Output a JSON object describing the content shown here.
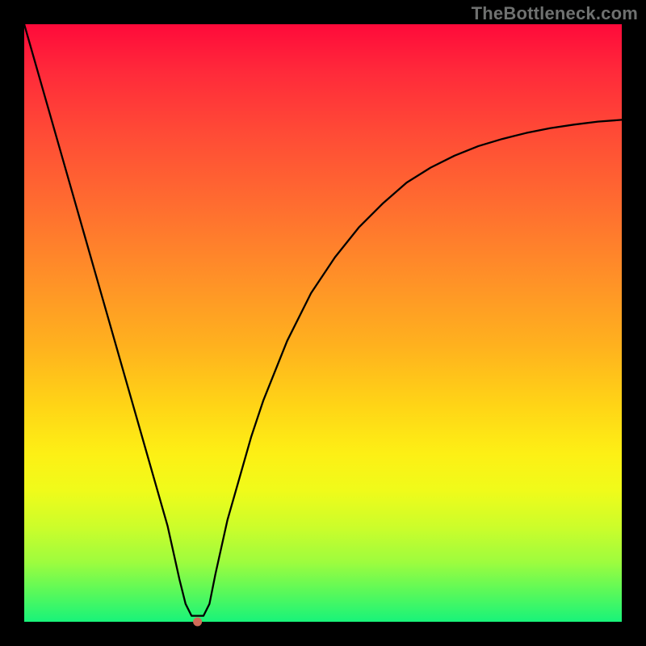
{
  "watermark": "TheBottleneck.com",
  "chart_data": {
    "type": "line",
    "title": "",
    "xlabel": "",
    "ylabel": "",
    "xlim": [
      0,
      100
    ],
    "ylim": [
      0,
      100
    ],
    "grid": false,
    "legend": false,
    "series": [
      {
        "name": "bottleneck-curve",
        "x": [
          0,
          2,
          4,
          6,
          8,
          10,
          12,
          14,
          16,
          18,
          20,
          22,
          24,
          26,
          27,
          28,
          29,
          30,
          31,
          32,
          34,
          36,
          38,
          40,
          44,
          48,
          52,
          56,
          60,
          64,
          68,
          72,
          76,
          80,
          84,
          88,
          92,
          96,
          100
        ],
        "y": [
          100,
          93,
          86,
          79,
          72,
          65,
          58,
          51,
          44,
          37,
          30,
          23,
          16,
          7,
          3,
          1,
          1,
          1,
          3,
          8,
          17,
          24,
          31,
          37,
          47,
          55,
          61,
          66,
          70,
          73.5,
          76,
          78,
          79.6,
          80.8,
          81.8,
          82.6,
          83.2,
          83.7,
          84.0
        ]
      }
    ],
    "marker": {
      "x": 29,
      "y": 0,
      "color": "#d06a58",
      "radius_px": 5
    },
    "background_gradient": {
      "stops": [
        {
          "pos": 0.0,
          "color": "#ff0a3a"
        },
        {
          "pos": 0.18,
          "color": "#ff4a36"
        },
        {
          "pos": 0.42,
          "color": "#ff8f28"
        },
        {
          "pos": 0.64,
          "color": "#ffd516"
        },
        {
          "pos": 0.78,
          "color": "#f0fb1a"
        },
        {
          "pos": 0.9,
          "color": "#9efc3e"
        },
        {
          "pos": 1.0,
          "color": "#18f37a"
        }
      ]
    }
  }
}
